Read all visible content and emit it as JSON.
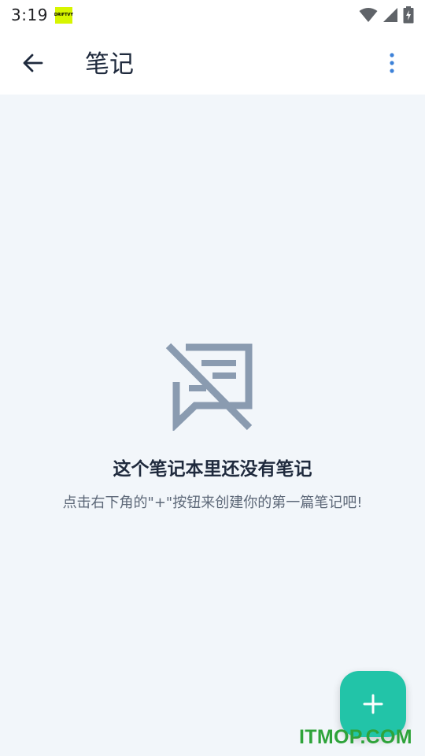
{
  "status_bar": {
    "time": "3:19",
    "app_badge_text": "DRIFTVY",
    "icons": [
      "wifi-icon",
      "signal-icon",
      "battery-charging-icon"
    ]
  },
  "app_bar": {
    "title": "笔记",
    "back_icon": "arrow-left-icon",
    "more_icon": "more-vertical-icon"
  },
  "empty_state": {
    "icon": "no-notes-icon",
    "title": "这个笔记本里还没有笔记",
    "subtitle": "点击右下角的\"+\"按钮来创建你的第一篇笔记吧!"
  },
  "fab": {
    "icon": "plus-icon"
  },
  "watermark": "ITMOP.COM",
  "colors": {
    "accent": "#22c4a8",
    "title": "#1f2a3d",
    "subtitle": "#5d6878",
    "icon_gray": "#8a9bb0",
    "more_blue": "#3d82d8",
    "background": "#f2f6fa"
  }
}
